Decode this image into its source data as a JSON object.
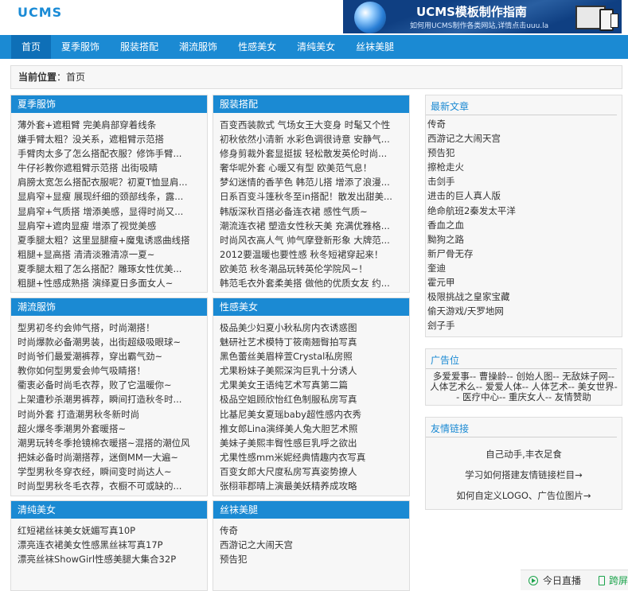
{
  "header": {
    "logo": "UCMS",
    "banner_title": "UCMS模板制作指南",
    "banner_sub": "如何用UCMS制作各类网站,详情点击uuu.la"
  },
  "nav": [
    "首页",
    "夏季服饰",
    "服装搭配",
    "潮流服饰",
    "性感美女",
    "清纯美女",
    "丝袜美腿"
  ],
  "breadcrumb": {
    "label": "当前位置",
    "sep": "：",
    "current": "首页"
  },
  "boxes": {
    "summer": {
      "title": "夏季服饰",
      "items": [
        "薄外套+遮粗臂 完美肩部穿着线条",
        "嫌手臂太粗？没关系，遮粗臂示范搭",
        "手臂肉太多了怎么搭配衣服？修饰手臂...",
        "牛仔衫教你遮粗臂示范搭 出街吸睛",
        "肩膀太宽怎么搭配衣服呢？初夏T恤显肩...",
        "显肩窄+显瘦 展现纤细的颈部线条，露...",
        "显肩窄+气质搭 增添美感，显得时尚又...",
        "显肩窄+遮肉显瘦 增添了视觉美感",
        "夏季腿太粗？这里显腿瘦+魔鬼诱惑曲线搭",
        "粗腿+显高搭 清清淡雅清凉一夏~",
        "夏季腿太粗了怎么搭配？雕琢女性优美...",
        "粗腿+性感成熟搭 演绎夏日多面女人~"
      ]
    },
    "match": {
      "title": "服装搭配",
      "items": [
        "百变西装款式 气场女王大变身 时髦又个性",
        "初秋依然小清新 水彩色调很诗意 安静气...",
        "修身剪裁外套显挺拔 轻松散发英伦时尚...",
        "奢华呢外套 心暖又有型 欧美范气息！",
        "梦幻迷情的香芋色 韩范儿搭 增添了浪漫...",
        "日系百变斗篷秋冬至in搭配！散发出甜美...",
        "韩版深秋百搭必备连衣裙 感性气质~",
        "潮流连衣裙 塑造女性秋天美 充满优雅格...",
        "时尚风衣高人气 帅气摩登新形象 大牌范...",
        "2012要温暖也要性感 秋冬短裙穿起来！",
        "欧美范 秋冬潮品玩转英伦学院风~！",
        "韩范毛衣外套柔美搭 做他的优质女友 约..."
      ]
    },
    "trend": {
      "title": "潮流服饰",
      "items": [
        "型男初冬约会帅气搭，时尚潮搭！",
        "时尚爆款必备潮男装，出街超级吸眼球~",
        "时尚爷们最爱潮裤荐，穿出霸气劲~",
        "教你如何型男爱会帅气吸睛搭！",
        "衢衷必备时尚毛衣荐，败了它温暖你~",
        "上架遭秒杀潮男裤荐，瞬间打造秋冬时...",
        "时尚外套 打造潮男秋冬新时尚",
        "超火爆冬季潮男外套暖搭~",
        "潮男玩转冬季抢镜棉衣暖搭~混搭的潮位风",
        "把妹必备时尚潮搭荐，迷倒MM一大遍~",
        "学型男秋冬穿衣经，瞬间变时尚达人~",
        "时尚型男秋冬毛衣荐，衣橱不可或缺的..."
      ]
    },
    "sexy": {
      "title": "性感美女",
      "items": [
        "极品美少妇夏小秋私房内衣诱惑图",
        "魅研社艺术模特丁筱南翘臀拍写真",
        "黑色蕾丝美眉梓萱Crystal私房照",
        "尤果粉妹子美熙深沟巨乳十分诱人",
        "尤果美女王语纯艺术写真第二篇",
        "极品空姐顾欣怡红色制服私房写真",
        "比基尼美女夏瑶baby超性感内衣秀",
        "推女郎Lina演绎美人兔大胆艺术照",
        "美妹子美熙丰臀性感巨乳呼之欲出",
        "尤果性感mm米妮经典情趣内衣写真",
        "百变女郎大尺度私房写真姿势撩人",
        "张栩菲郡晴上演最美妖精养成攻略"
      ]
    },
    "pure": {
      "title": "清纯美女",
      "items": [
        "红短裙丝袜美女妩媚写真10P",
        "漂亮连衣裙美女性感黑丝袜写真17P",
        "漂亮丝袜ShowGirl性感美腿大集合32P"
      ]
    },
    "stock": {
      "title": "丝袜美腿",
      "items": [
        "传奇",
        "西游记之大闹天宫",
        "预告犯"
      ]
    }
  },
  "sidebar": {
    "latest": {
      "title": "最新文章",
      "items": [
        "传奇",
        "西游记之大闹天宫",
        "预告犯",
        "擦枪走火",
        "击剑手",
        "进击的巨人真人版",
        "绝命航班2秦发太平洋",
        "香血之血",
        "黝狗之路",
        "新尸骨无存",
        "奎迪",
        "霍元甲",
        "极限挑战之皇家宝藏",
        "偷天游戏/天罗地网",
        "刽子手"
      ]
    },
    "ads": {
      "title": "广告位",
      "text": "多爱爱事-- 曹操龄-- 创始人图-- 无敌妹子网-- 人体艺术么-- 爱爱人体-- 人体艺术-- 美女世界-- 医疗中心-- 重庆女人-- 友情赞助"
    },
    "links": {
      "title": "友情链接",
      "items": [
        "自己动手,丰衣足食",
        "学习如何搭建友情链接栏目→",
        "如何自定义LOGO、广告位图片→"
      ]
    }
  },
  "footbar": {
    "live": "今日直播",
    "next": "跨屏"
  },
  "colors": {
    "brand": "#1b8ad3",
    "brand_dark": "#0e6fb7",
    "border": "#dddddd",
    "panel": "#f7f7f7",
    "green": "#1aa34a"
  }
}
